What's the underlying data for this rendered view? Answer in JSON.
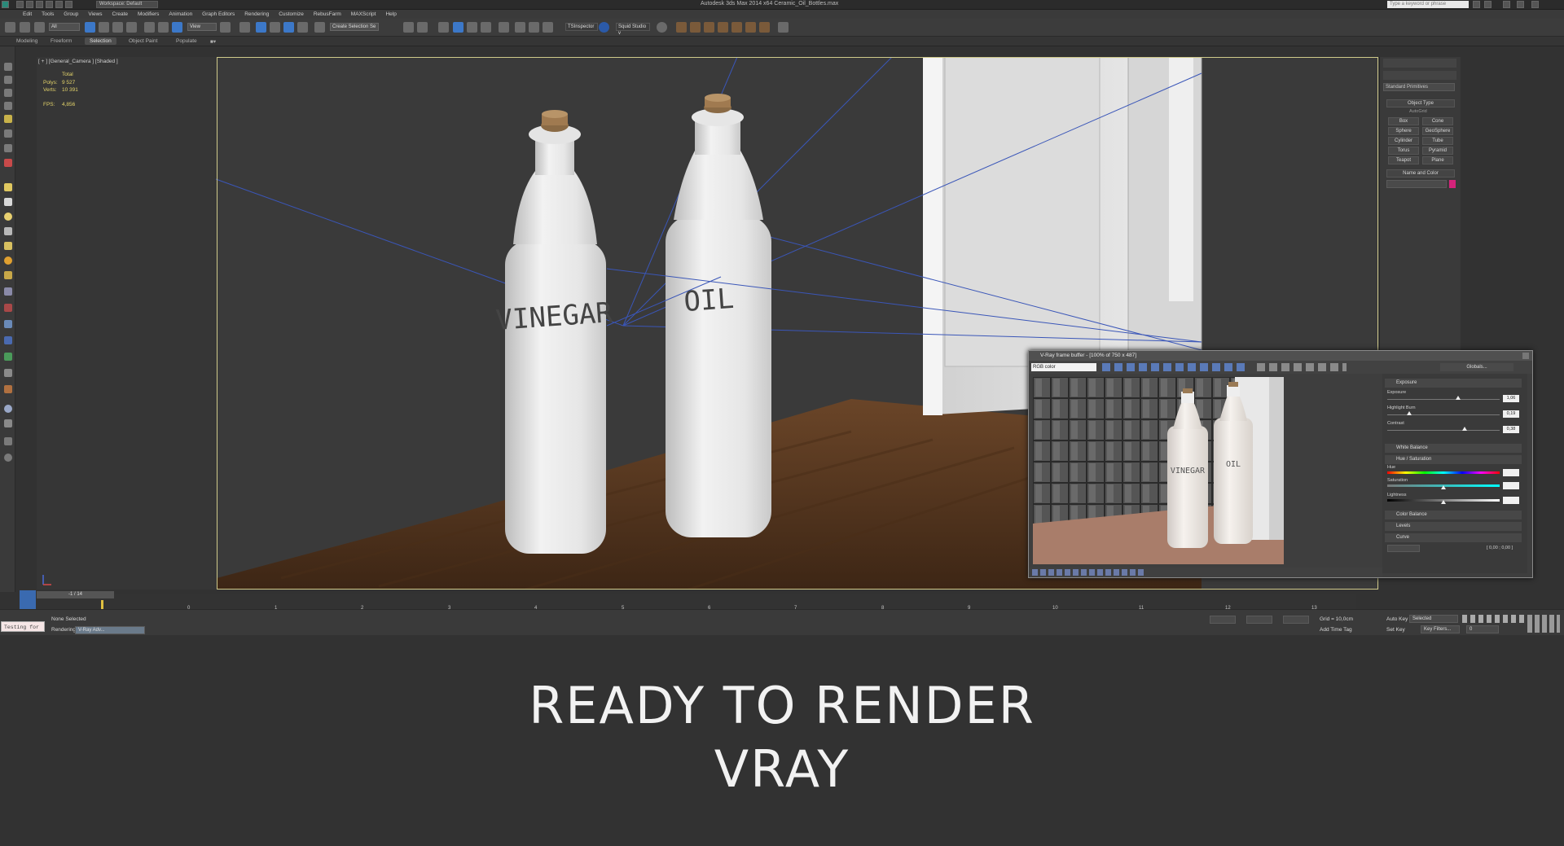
{
  "titlebar": {
    "app_title": "Autodesk 3ds Max  2014 x64     Ceramic_Oil_Bottles.max",
    "workspace": "Workspace: Default",
    "search_placeholder": "Type a keyword or phrase"
  },
  "menu": [
    "Edit",
    "Tools",
    "Group",
    "Views",
    "Create",
    "Modifiers",
    "Animation",
    "Graph Editors",
    "Rendering",
    "Customize",
    "RebusFarm",
    "MAXScript",
    "Help"
  ],
  "toolbar": {
    "filter": "All",
    "ref_coord": "View",
    "named_selection": "Create Selection Se",
    "ts_inspector": "TSInspector",
    "squid": "Squid Studio v"
  },
  "ribbon_tabs": [
    {
      "label": "Modeling",
      "active": false
    },
    {
      "label": "Freeform",
      "active": false
    },
    {
      "label": "Selection",
      "active": true
    },
    {
      "label": "Object Paint",
      "active": false
    },
    {
      "label": "Populate",
      "active": false
    }
  ],
  "viewport": {
    "label": "[ + ] [General_Camera ] [Shaded ]",
    "stats": {
      "header": "Total",
      "polys_label": "Polys:",
      "polys": "9 527",
      "verts_label": "Verts:",
      "verts": "10 391",
      "fps_label": "FPS:",
      "fps": "4,856"
    },
    "bottle_text_1": "VINEGAR",
    "bottle_text_2": "OIL",
    "colors": {
      "frame": "#cfc98a",
      "wood": "#5c3a22",
      "bottle": "#e9e9e9"
    }
  },
  "command_panel": {
    "dropdown": "Standard Primitives",
    "object_type_title": "Object Type",
    "autogrid": "AutoGrid",
    "buttons": [
      "Box",
      "Cone",
      "Sphere",
      "GeoSphere",
      "Cylinder",
      "Tube",
      "Torus",
      "Pyramid",
      "Teapot",
      "Plane"
    ],
    "name_color_title": "Name and Color",
    "color_swatch": "#d4237a"
  },
  "vfb": {
    "title": "V-Ray frame buffer - [100% of 750 x 487]",
    "channel": "RGB color",
    "globals": "Globals...",
    "render_text_1": "VINEGAR",
    "render_text_2": "OIL",
    "exposure": {
      "label": "Exposure",
      "exposure_label": "Exposure",
      "exposure_value": "1,06",
      "highlight_label": "Highlight Burn",
      "highlight_value": "0,19",
      "contrast_label": "Contrast",
      "contrast_value": "0,38"
    },
    "white_balance": "White Balance",
    "hue_sat": "Hue / Saturation",
    "hue_label": "Hue",
    "saturation_label": "Saturation",
    "lightness_label": "Lightness",
    "color_balance": "Color Balance",
    "levels": "Levels",
    "curve": "Curve",
    "curve_readout": "[ 0,00 ; 0,00 ]"
  },
  "timeline": {
    "slider": "-1 / 14",
    "ticks": [
      "0",
      "1",
      "2",
      "3",
      "4",
      "5",
      "6",
      "7",
      "8",
      "9",
      "10",
      "11",
      "12",
      "13"
    ]
  },
  "statusbar": {
    "listener": "Testing for",
    "selection": "None Selected",
    "rendering_label": "Rendering",
    "render_progress": "V-Ray  Adv...",
    "grid": "Grid = 10,0cm",
    "add_time_tag": "Add Time Tag",
    "auto_key": "Auto Key",
    "selected": "Selected",
    "set_key": "Set Key",
    "key_filters": "Key Filters...",
    "frame": "0"
  },
  "caption": {
    "line1": "READY TO RENDER",
    "line2": "VRAY"
  }
}
